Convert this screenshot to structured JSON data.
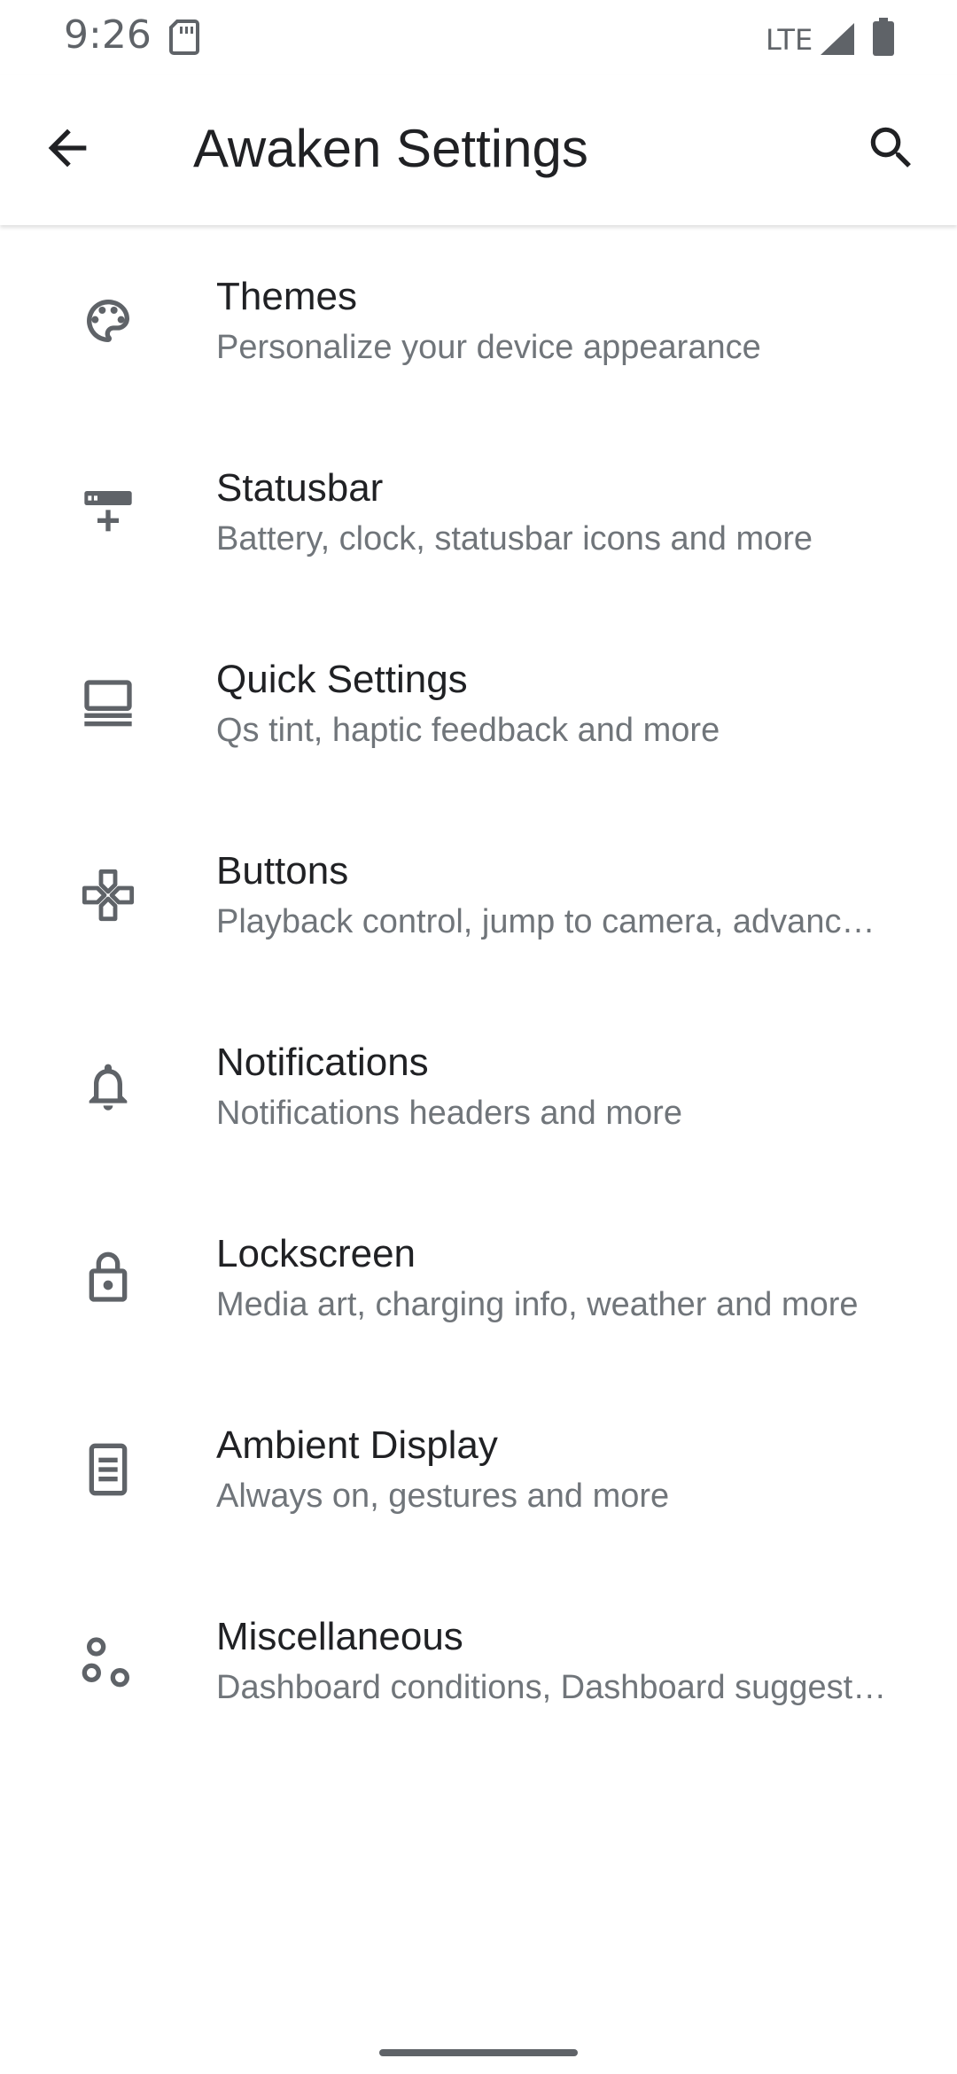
{
  "status_bar": {
    "time": "9:26",
    "network": "LTE",
    "icons": [
      "sd-card-icon",
      "signal-icon",
      "battery-icon"
    ]
  },
  "toolbar": {
    "title": "Awaken Settings",
    "back_icon": "arrow-back-icon",
    "search_icon": "search-icon"
  },
  "items": [
    {
      "title": "Themes",
      "summary": "Personalize your device appearance",
      "icon": "palette-icon"
    },
    {
      "title": "Statusbar",
      "summary": "Battery, clock, statusbar icons and more",
      "icon": "statusbar-icon"
    },
    {
      "title": "Quick Settings",
      "summary": "Qs tint, haptic feedback and more",
      "icon": "quick-settings-icon"
    },
    {
      "title": "Buttons",
      "summary": "Playback control, jump to camera, advanc…",
      "icon": "buttons-icon"
    },
    {
      "title": "Notifications",
      "summary": "Notifications headers and more",
      "icon": "bell-icon"
    },
    {
      "title": "Lockscreen",
      "summary": "Media art, charging info, weather and more",
      "icon": "lock-icon"
    },
    {
      "title": "Ambient Display",
      "summary": "Always on, gestures and more",
      "icon": "ambient-display-icon"
    },
    {
      "title": "Miscellaneous",
      "summary": "Dashboard conditions, Dashboard suggest…",
      "icon": "misc-icon"
    }
  ],
  "colors": {
    "text_primary": "#202124",
    "text_secondary": "#70757a",
    "icon": "#5f6368",
    "background": "#ffffff"
  }
}
